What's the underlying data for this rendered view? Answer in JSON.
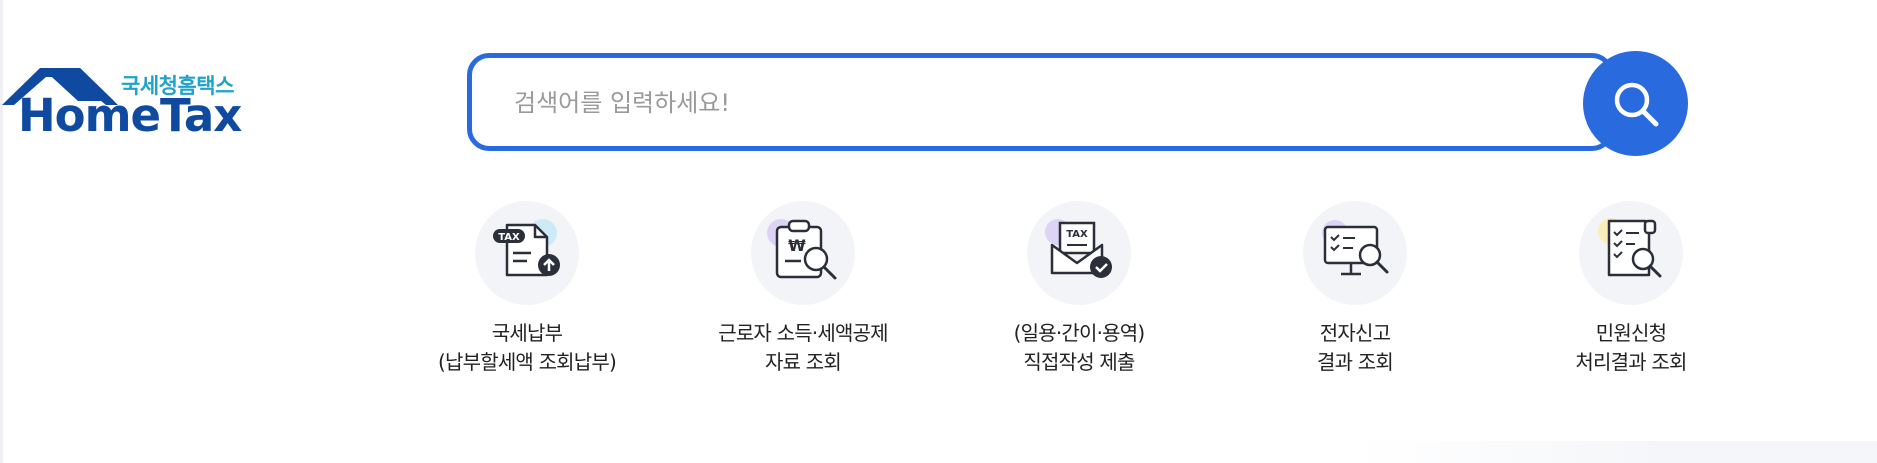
{
  "logo": {
    "korean": "국세청홈택스",
    "english": "HomeTax"
  },
  "search": {
    "placeholder": "검색어를 입력하세요!",
    "value": ""
  },
  "colors": {
    "accent": "#2a6adf",
    "logo_blue": "#0f4aa0",
    "logo_teal": "#1fa3c9"
  },
  "quick_menu": [
    {
      "line1": "국세납부",
      "line2": "(납부할세액 조회납부)",
      "icon": "tax-payment-icon"
    },
    {
      "line1": "근로자 소득·세액공제",
      "line2": "자료 조회",
      "icon": "deduction-inquiry-icon"
    },
    {
      "line1": "(일용·간이·용역)",
      "line2": "직접작성 제출",
      "icon": "tax-envelope-icon"
    },
    {
      "line1": "전자신고",
      "line2": "결과 조회",
      "icon": "monitor-search-icon"
    },
    {
      "line1": "민원신청",
      "line2": "처리결과 조회",
      "icon": "checklist-search-icon"
    }
  ]
}
